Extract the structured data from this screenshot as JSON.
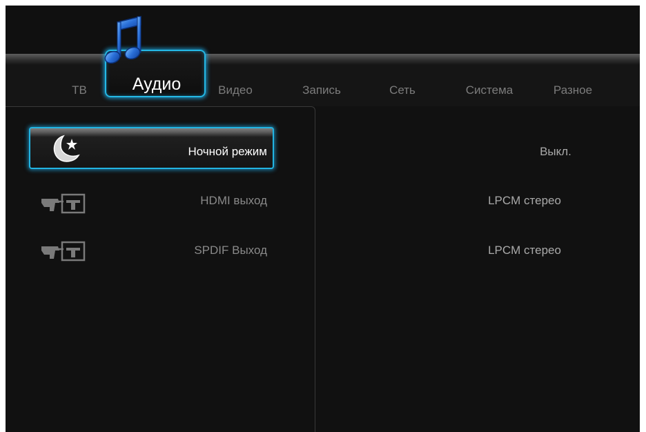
{
  "tabs": [
    {
      "label": "ТВ",
      "active": false
    },
    {
      "label": "Аудио",
      "active": true
    },
    {
      "label": "Видео",
      "active": false
    },
    {
      "label": "Запись",
      "active": false
    },
    {
      "label": "Сеть",
      "active": false
    },
    {
      "label": "Система",
      "active": false
    },
    {
      "label": "Разное",
      "active": false
    }
  ],
  "settings": [
    {
      "label": "Ночной режим",
      "value": "Выкл.",
      "icon": "night-mode-icon",
      "selected": true
    },
    {
      "label": "HDMI выход",
      "value": "LPCM стерео",
      "icon": "audio-output-icon",
      "selected": false
    },
    {
      "label": "SPDIF Выход",
      "value": "LPCM стерео",
      "icon": "audio-output-icon",
      "selected": false
    }
  ],
  "colors": {
    "accent": "#24b9e6",
    "background": "#101010",
    "music_icon": "#2a6fd8"
  }
}
